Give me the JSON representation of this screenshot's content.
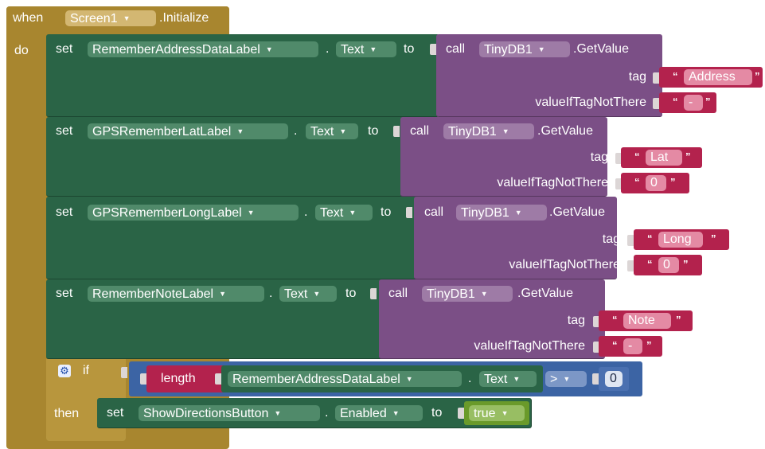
{
  "event": {
    "when_label": "when",
    "component": "Screen1",
    "event_name": ".Initialize",
    "do_label": "do"
  },
  "common": {
    "set_label": "set",
    "dot_label": ".",
    "to_label": "to",
    "call_label": "call",
    "getvalue_label": ".GetValue",
    "tag_label": "tag",
    "fallback_label": "valueIfTagNotThere",
    "db_component": "TinyDB1",
    "text_property": "Text",
    "open_quote": "“",
    "close_quote": "”"
  },
  "statements": [
    {
      "label_component": "RememberAddressDataLabel",
      "tag_value": "Address",
      "fallback_value": "-"
    },
    {
      "label_component": "GPSRememberLatLabel",
      "tag_value": "Lat",
      "fallback_value": "0"
    },
    {
      "label_component": "GPSRememberLongLabel",
      "tag_value": "Long",
      "fallback_value": "0"
    },
    {
      "label_component": "RememberNoteLabel",
      "tag_value": "Note",
      "fallback_value": "-"
    }
  ],
  "if_block": {
    "if_label": "if",
    "then_label": "then",
    "length_label": "length",
    "length_component": "RememberAddressDataLabel",
    "length_property": "Text",
    "operator": ">",
    "compare_value": "0",
    "then_set": {
      "set_label": "set",
      "component": "ShowDirectionsButton",
      "property": "Enabled",
      "to_label": "to",
      "value": "true"
    }
  },
  "colors": {
    "event": "#a8862f",
    "component_set": "#2a6446",
    "component_call": "#7b4f86",
    "text": "#b3224d",
    "math": "#3c64a4",
    "logic": "#6a9a2a"
  }
}
